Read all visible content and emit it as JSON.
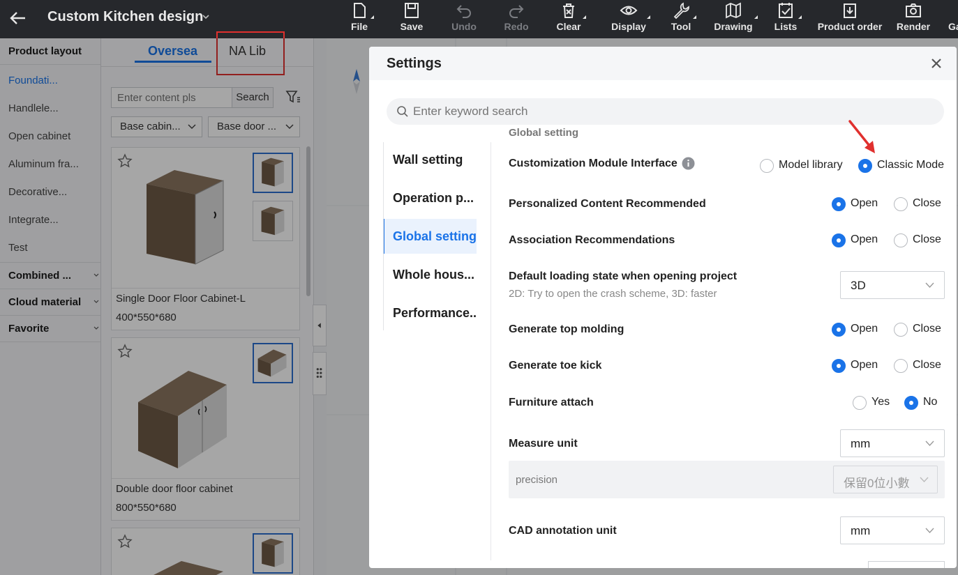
{
  "header": {
    "title": "Custom Kitchen design",
    "tools": [
      {
        "label": "File",
        "icon": "file-icon",
        "enabled": true
      },
      {
        "label": "Save",
        "icon": "save-icon",
        "enabled": true
      },
      {
        "label": "Undo",
        "icon": "undo-icon",
        "enabled": false
      },
      {
        "label": "Redo",
        "icon": "redo-icon",
        "enabled": false
      },
      {
        "label": "Clear",
        "icon": "clear-icon",
        "enabled": true
      },
      {
        "label": "Display",
        "icon": "eye-icon",
        "enabled": true
      },
      {
        "label": "Tool",
        "icon": "wrench-icon",
        "enabled": true
      },
      {
        "label": "Drawing",
        "icon": "map-icon",
        "enabled": true
      },
      {
        "label": "Lists",
        "icon": "checklist-icon",
        "enabled": true
      },
      {
        "label": "Product order",
        "icon": "order-icon",
        "enabled": true
      },
      {
        "label": "Render",
        "icon": "camera-icon",
        "enabled": true
      },
      {
        "label": "Ga",
        "icon": "",
        "enabled": true
      }
    ]
  },
  "sidebar": {
    "product_layout": "Product layout",
    "items": [
      "Foundati...",
      "Handlele...",
      "Open cabinet",
      "Aluminum fra...",
      "Decorative...",
      "Integrate...",
      "Test"
    ],
    "combined": "Combined ...",
    "cloud_material": "Cloud material",
    "favorite": "Favorite"
  },
  "library": {
    "tabs": [
      "Oversea",
      "NA Lib"
    ],
    "search_placeholder": "Enter content pls",
    "search_button": "Search",
    "filter1": "Base cabin...",
    "filter2": "Base door ...",
    "cards": [
      {
        "name": "Single Door Floor Cabinet-L",
        "size": "400*550*680"
      },
      {
        "name": "Double door floor cabinet",
        "size": "800*550*680"
      },
      {
        "name": "",
        "size": ""
      }
    ]
  },
  "settings": {
    "title": "Settings",
    "search_placeholder": "Enter keyword search",
    "nav": [
      "Wall setting",
      "Operation p...",
      "Global setting",
      "Whole hous...",
      "Performance..."
    ],
    "active_nav": "Global setting",
    "section_label": "Global setting",
    "rows": {
      "customization": {
        "label": "Customization Module Interface",
        "options": [
          "Model library",
          "Classic Mode"
        ],
        "selected": "Classic Mode"
      },
      "personalized": {
        "label": "Personalized Content Recommended",
        "options": [
          "Open",
          "Close"
        ],
        "selected": "Open"
      },
      "association": {
        "label": "Association Recommendations",
        "options": [
          "Open",
          "Close"
        ],
        "selected": "Open"
      },
      "default_loading": {
        "label": "Default loading state when opening project",
        "sub": "2D: Try to open the crash scheme, 3D: faster",
        "value": "3D"
      },
      "top_molding": {
        "label": "Generate top molding",
        "options": [
          "Open",
          "Close"
        ],
        "selected": "Open"
      },
      "toe_kick": {
        "label": "Generate toe kick",
        "options": [
          "Open",
          "Close"
        ],
        "selected": "Open"
      },
      "furniture_attach": {
        "label": "Furniture attach",
        "options": [
          "Yes",
          "No"
        ],
        "selected": "No"
      },
      "measure_unit": {
        "label": "Measure unit",
        "value": "mm"
      },
      "precision": {
        "label": "precision",
        "value": "保留0位小數"
      },
      "cad_unit": {
        "label": "CAD annotation unit",
        "value": "mm"
      }
    }
  },
  "colors": {
    "accent": "#1a73e8",
    "annotation_red": "#e0302e",
    "topbar": "#26282c"
  }
}
